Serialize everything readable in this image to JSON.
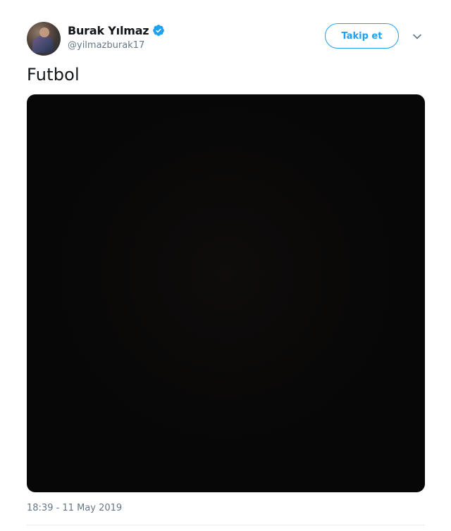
{
  "author": {
    "display_name": "Burak Yılmaz",
    "handle": "@yilmazburak17",
    "verified": true
  },
  "actions": {
    "follow_label": "Takip et",
    "more_icon": "chevron-down-icon"
  },
  "tweet": {
    "text": "Futbol",
    "media": "dark-photo",
    "timestamp": "18:39 - 11 May 2019"
  },
  "colors": {
    "accent": "#1da1f2",
    "secondary_text": "#657786",
    "primary_text": "#14171a",
    "media_bg": "#070707"
  }
}
